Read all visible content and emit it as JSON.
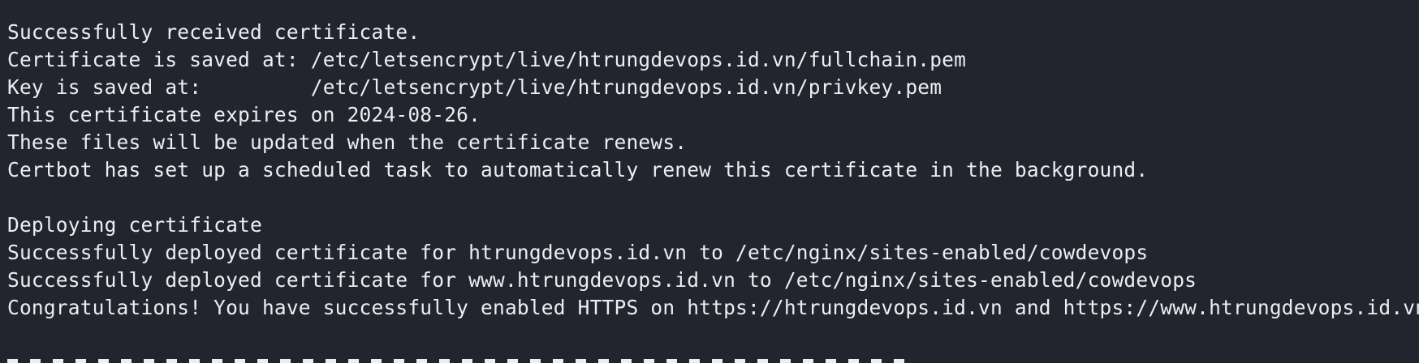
{
  "terminal": {
    "lines": [
      "Successfully received certificate.",
      "Certificate is saved at: /etc/letsencrypt/live/htrungdevops.id.vn/fullchain.pem",
      "Key is saved at:         /etc/letsencrypt/live/htrungdevops.id.vn/privkey.pem",
      "This certificate expires on 2024-08-26.",
      "These files will be updated when the certificate renews.",
      "Certbot has set up a scheduled task to automatically renew this certificate in the background.",
      "",
      "Deploying certificate",
      "Successfully deployed certificate for htrungdevops.id.vn to /etc/nginx/sites-enabled/cowdevops",
      "Successfully deployed certificate for www.htrungdevops.id.vn to /etc/nginx/sites-enabled/cowdevops",
      "Congratulations! You have successfully enabled HTTPS on https://htrungdevops.id.vn and https://www.htrungdevops.id.vn"
    ]
  },
  "colors": {
    "background": "#23252e",
    "text": "#eceef2"
  }
}
